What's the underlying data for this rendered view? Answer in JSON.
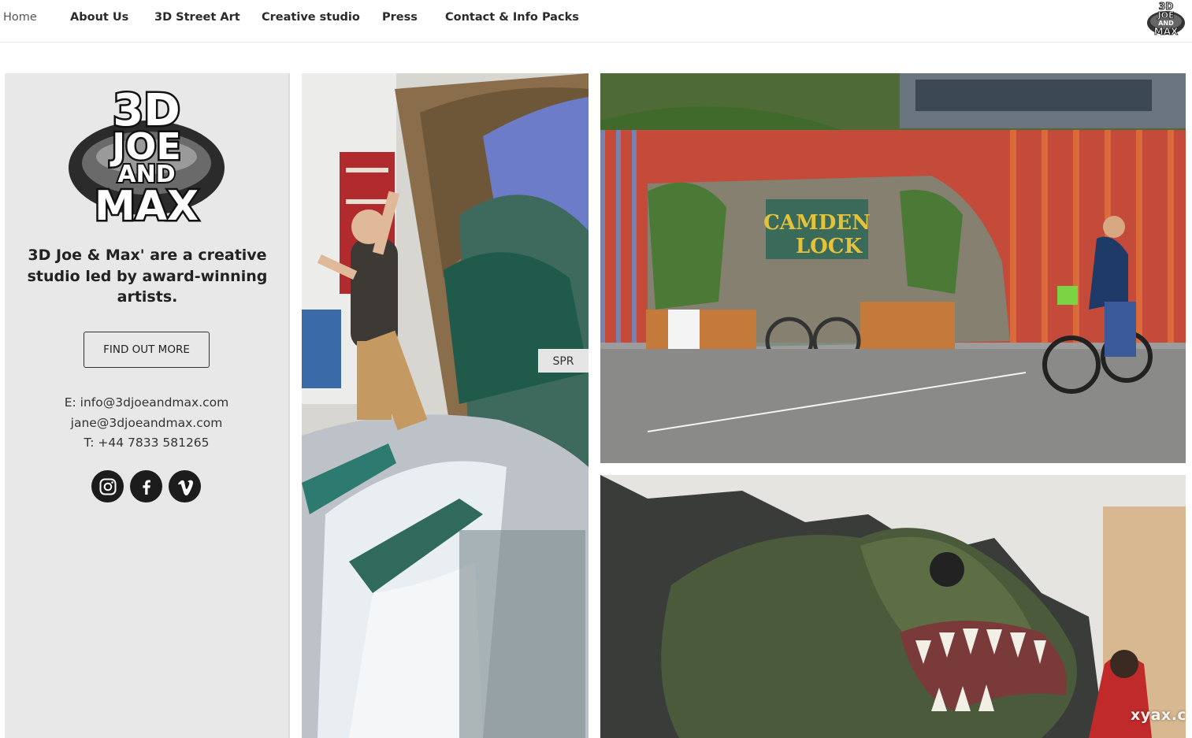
{
  "nav": {
    "items": [
      {
        "label": "Home"
      },
      {
        "label": "About Us"
      },
      {
        "label": "3D Street Art"
      },
      {
        "label": "Creative studio"
      },
      {
        "label": "Press"
      },
      {
        "label": "Contact & Info Packs"
      }
    ],
    "logo": {
      "line1": "3D",
      "line2": "JOE",
      "line3": "AND",
      "line4": "MAX"
    }
  },
  "sidebar": {
    "logo": {
      "line1": "3D",
      "line2": "JOE",
      "line3": "AND",
      "line4": "MAX"
    },
    "tagline": "3D Joe & Max' are a creative studio led by award-winning artists.",
    "cta_label": "FIND OUT MORE",
    "contact": {
      "email1": "E: info@3djoeandmax.com",
      "email2": "jane@3djoeandmax.com",
      "phone": "T: +44 7833 581265"
    },
    "socials": [
      {
        "icon": "instagram-icon"
      },
      {
        "icon": "facebook-icon"
      },
      {
        "icon": "vimeo-icon"
      }
    ]
  },
  "gallery": {
    "camden_sign_line1": "CAMDEN",
    "camden_sign_line2": "LOCK",
    "surf_plate": "SPR",
    "watermark": "xyax.c"
  },
  "colors": {
    "panel_bg": "#e8e8e8",
    "text_dark": "#222222",
    "nav_border": "#e4e4e4"
  }
}
